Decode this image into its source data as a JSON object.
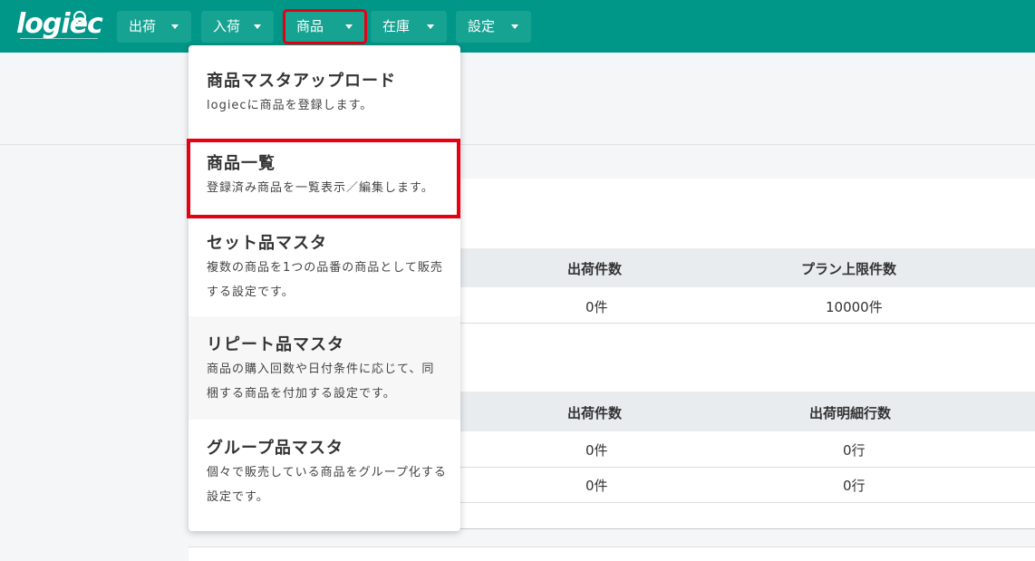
{
  "app": {
    "logo": "logiec"
  },
  "nav": [
    {
      "label": "出荷"
    },
    {
      "label": "入荷"
    },
    {
      "label": "商品"
    },
    {
      "label": "在庫"
    },
    {
      "label": "設定"
    }
  ],
  "dropdown": [
    {
      "title": "商品マスタアップロード",
      "desc": "logiecに商品を登録します。"
    },
    {
      "title": "商品一覧",
      "desc": "登録済み商品を一覧表示／編集します。"
    },
    {
      "title": "セット品マスタ",
      "desc": "複数の商品を1つの品番の商品として販売する設定です。"
    },
    {
      "title": "リピート品マスタ",
      "desc": "商品の購入回数や日付条件に応じて、同梱する商品を付加する設定です。"
    },
    {
      "title": "グループ品マスタ",
      "desc": "個々で販売している商品をグループ化する設定です。"
    }
  ],
  "table1": {
    "headers": [
      "出荷件数",
      "プラン上限件数"
    ],
    "rows": [
      [
        "0件",
        "10000件"
      ]
    ]
  },
  "table2": {
    "headers": [
      "出荷件数",
      "出荷明細行数"
    ],
    "rows": [
      [
        "0件",
        "0行"
      ],
      [
        "0件",
        "0行"
      ]
    ]
  },
  "colors": {
    "brand": "#009688",
    "highlight": "#e60012"
  }
}
